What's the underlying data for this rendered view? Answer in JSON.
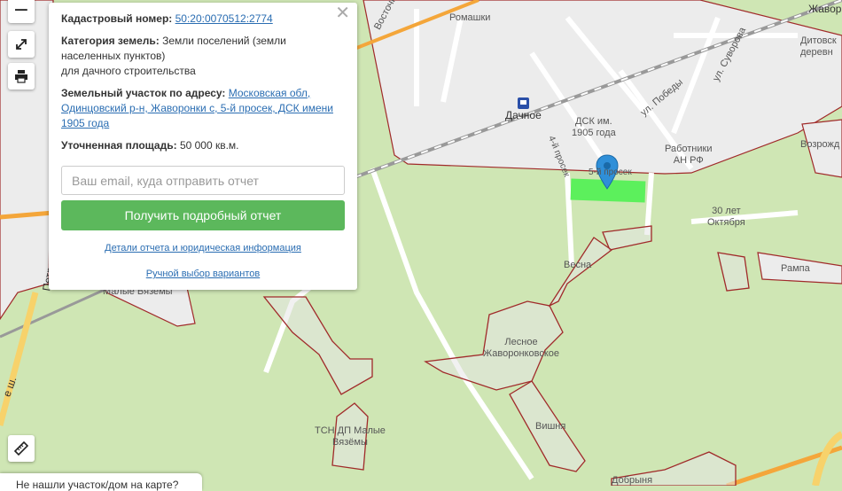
{
  "map": {
    "labels": {
      "romashki": "Ромашки",
      "vostochnaya": "Восточная ул.",
      "suvorova": "ул. Суворова",
      "zhavoronki": "Жавор",
      "derevnya": "Дитовск\nдеревн",
      "dachnoe": "Дачное",
      "dsk": "ДСК им.\n1905 года",
      "pobedy": "ул. Победы",
      "rabotniki": "Работники\nАН РФ",
      "vozrozhd": "Возрожд",
      "prosek4": "4-й просек",
      "prosek5": "5-й просек",
      "oktyabrya": "30 лет\nОктября",
      "vesna": "Весна",
      "rampa": "Рампа",
      "malye": "Малые Вяземы",
      "lesnoe": "Лесное\nЖаворонковское",
      "tsn": "ТСН ДП Малые\nВязёмы",
      "vishnya": "Вишня",
      "dobrynya": "Добрыня",
      "petrov": "Петров",
      "road_se": "е ш."
    }
  },
  "controls": {
    "zoom_out": "−",
    "fullscreen_icon": "fullscreen-icon",
    "print_icon": "printer-icon",
    "ruler_icon": "ruler-icon"
  },
  "panel": {
    "close": "✕",
    "cadastral_label": "Кадастровый номер:",
    "cadastral_value": "50:20:0070512:2774",
    "category_label": "Категория земель:",
    "category_value": "Земли поселений (земли населенных пунктов)",
    "category_sub": "для дачного строительства",
    "address_label": "Земельный участок по адресу:",
    "address_value": "Московская обл, Одинцовский р-н, Жаворонки с, 5-й просек, ДСК имени 1905 года",
    "area_label": "Уточненная площадь:",
    "area_value": "50 000 кв.м.",
    "email_placeholder": "Ваш email, куда отправить отчет",
    "submit": "Получить подробный отчет",
    "details_link": "Детали отчета и юридическая информация",
    "manual_link": "Ручной выбор вариантов"
  },
  "bottom_bubble": "Не нашли участок/дом на карте?",
  "colors": {
    "map_green": "#cfe6b4",
    "parcel_border": "#a02a2a",
    "parcel_fill": "#5cf05c",
    "marker": "#2f8fd8",
    "button": "#5cb85c",
    "link": "#2a6db2"
  }
}
